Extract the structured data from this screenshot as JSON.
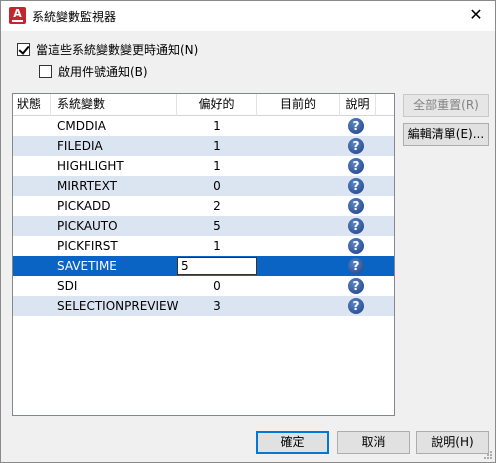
{
  "window": {
    "title": "系統變數監視器",
    "close_glyph": "✕",
    "icon_letter": "A"
  },
  "options": {
    "notify_label": "當這些系統變數變更時通知(N)",
    "notify_checked": true,
    "balloon_label": "啟用件號通知(B)",
    "balloon_checked": false
  },
  "table": {
    "columns": [
      "狀態",
      "系統變數",
      "偏好的",
      "目前的",
      "說明"
    ],
    "rows": [
      {
        "name": "CMDDIA",
        "preferred": "1",
        "current": ""
      },
      {
        "name": "FILEDIA",
        "preferred": "1",
        "current": ""
      },
      {
        "name": "HIGHLIGHT",
        "preferred": "1",
        "current": ""
      },
      {
        "name": "MIRRTEXT",
        "preferred": "0",
        "current": ""
      },
      {
        "name": "PICKADD",
        "preferred": "2",
        "current": ""
      },
      {
        "name": "PICKAUTO",
        "preferred": "5",
        "current": ""
      },
      {
        "name": "PICKFIRST",
        "preferred": "1",
        "current": ""
      },
      {
        "name": "SAVETIME",
        "preferred": "5",
        "current": "",
        "editing": true
      },
      {
        "name": "SDI",
        "preferred": "0",
        "current": ""
      },
      {
        "name": "SELECTIONPREVIEW",
        "preferred": "3",
        "current": ""
      }
    ],
    "help_glyph": "?"
  },
  "side_buttons": {
    "reset_all": "全部重置(R)",
    "edit_list": "編輯清單(E)..."
  },
  "footer": {
    "ok": "確定",
    "cancel": "取消",
    "help": "說明(H)"
  },
  "colors": {
    "selection": "#0a64c3",
    "alt_row": "#dbe5f1",
    "help_icon": "#1d3f82"
  }
}
